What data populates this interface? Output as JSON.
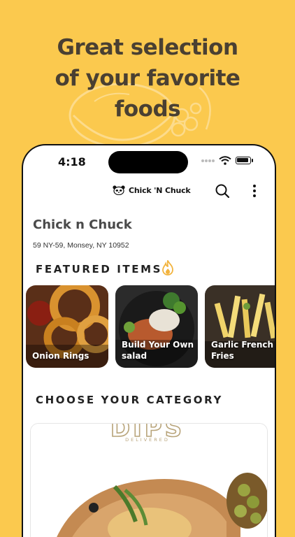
{
  "headline": {
    "line1": "Great selection",
    "line2": "of your favorite",
    "line3": "foods"
  },
  "status_bar": {
    "time": "4:18"
  },
  "navbar": {
    "logo_text": "Chick 'N Chuck"
  },
  "store": {
    "name": "Chick n Chuck",
    "address": "59 NY-59, Monsey, NY 10952"
  },
  "featured": {
    "title": "FEATURED ITEMS",
    "items": [
      {
        "label": "Onion Rings"
      },
      {
        "label": "Build Your Own salad"
      },
      {
        "label": "Garlic French Fries"
      }
    ]
  },
  "categories": {
    "title": "CHOOSE YOUR CATEGORY",
    "first_card": {
      "logo_text": "DIPS",
      "logo_subtext": "DELIVERED"
    }
  },
  "colors": {
    "background": "#FBC94E",
    "headline": "#4A4032",
    "accent_flame": "#F2B33D"
  }
}
